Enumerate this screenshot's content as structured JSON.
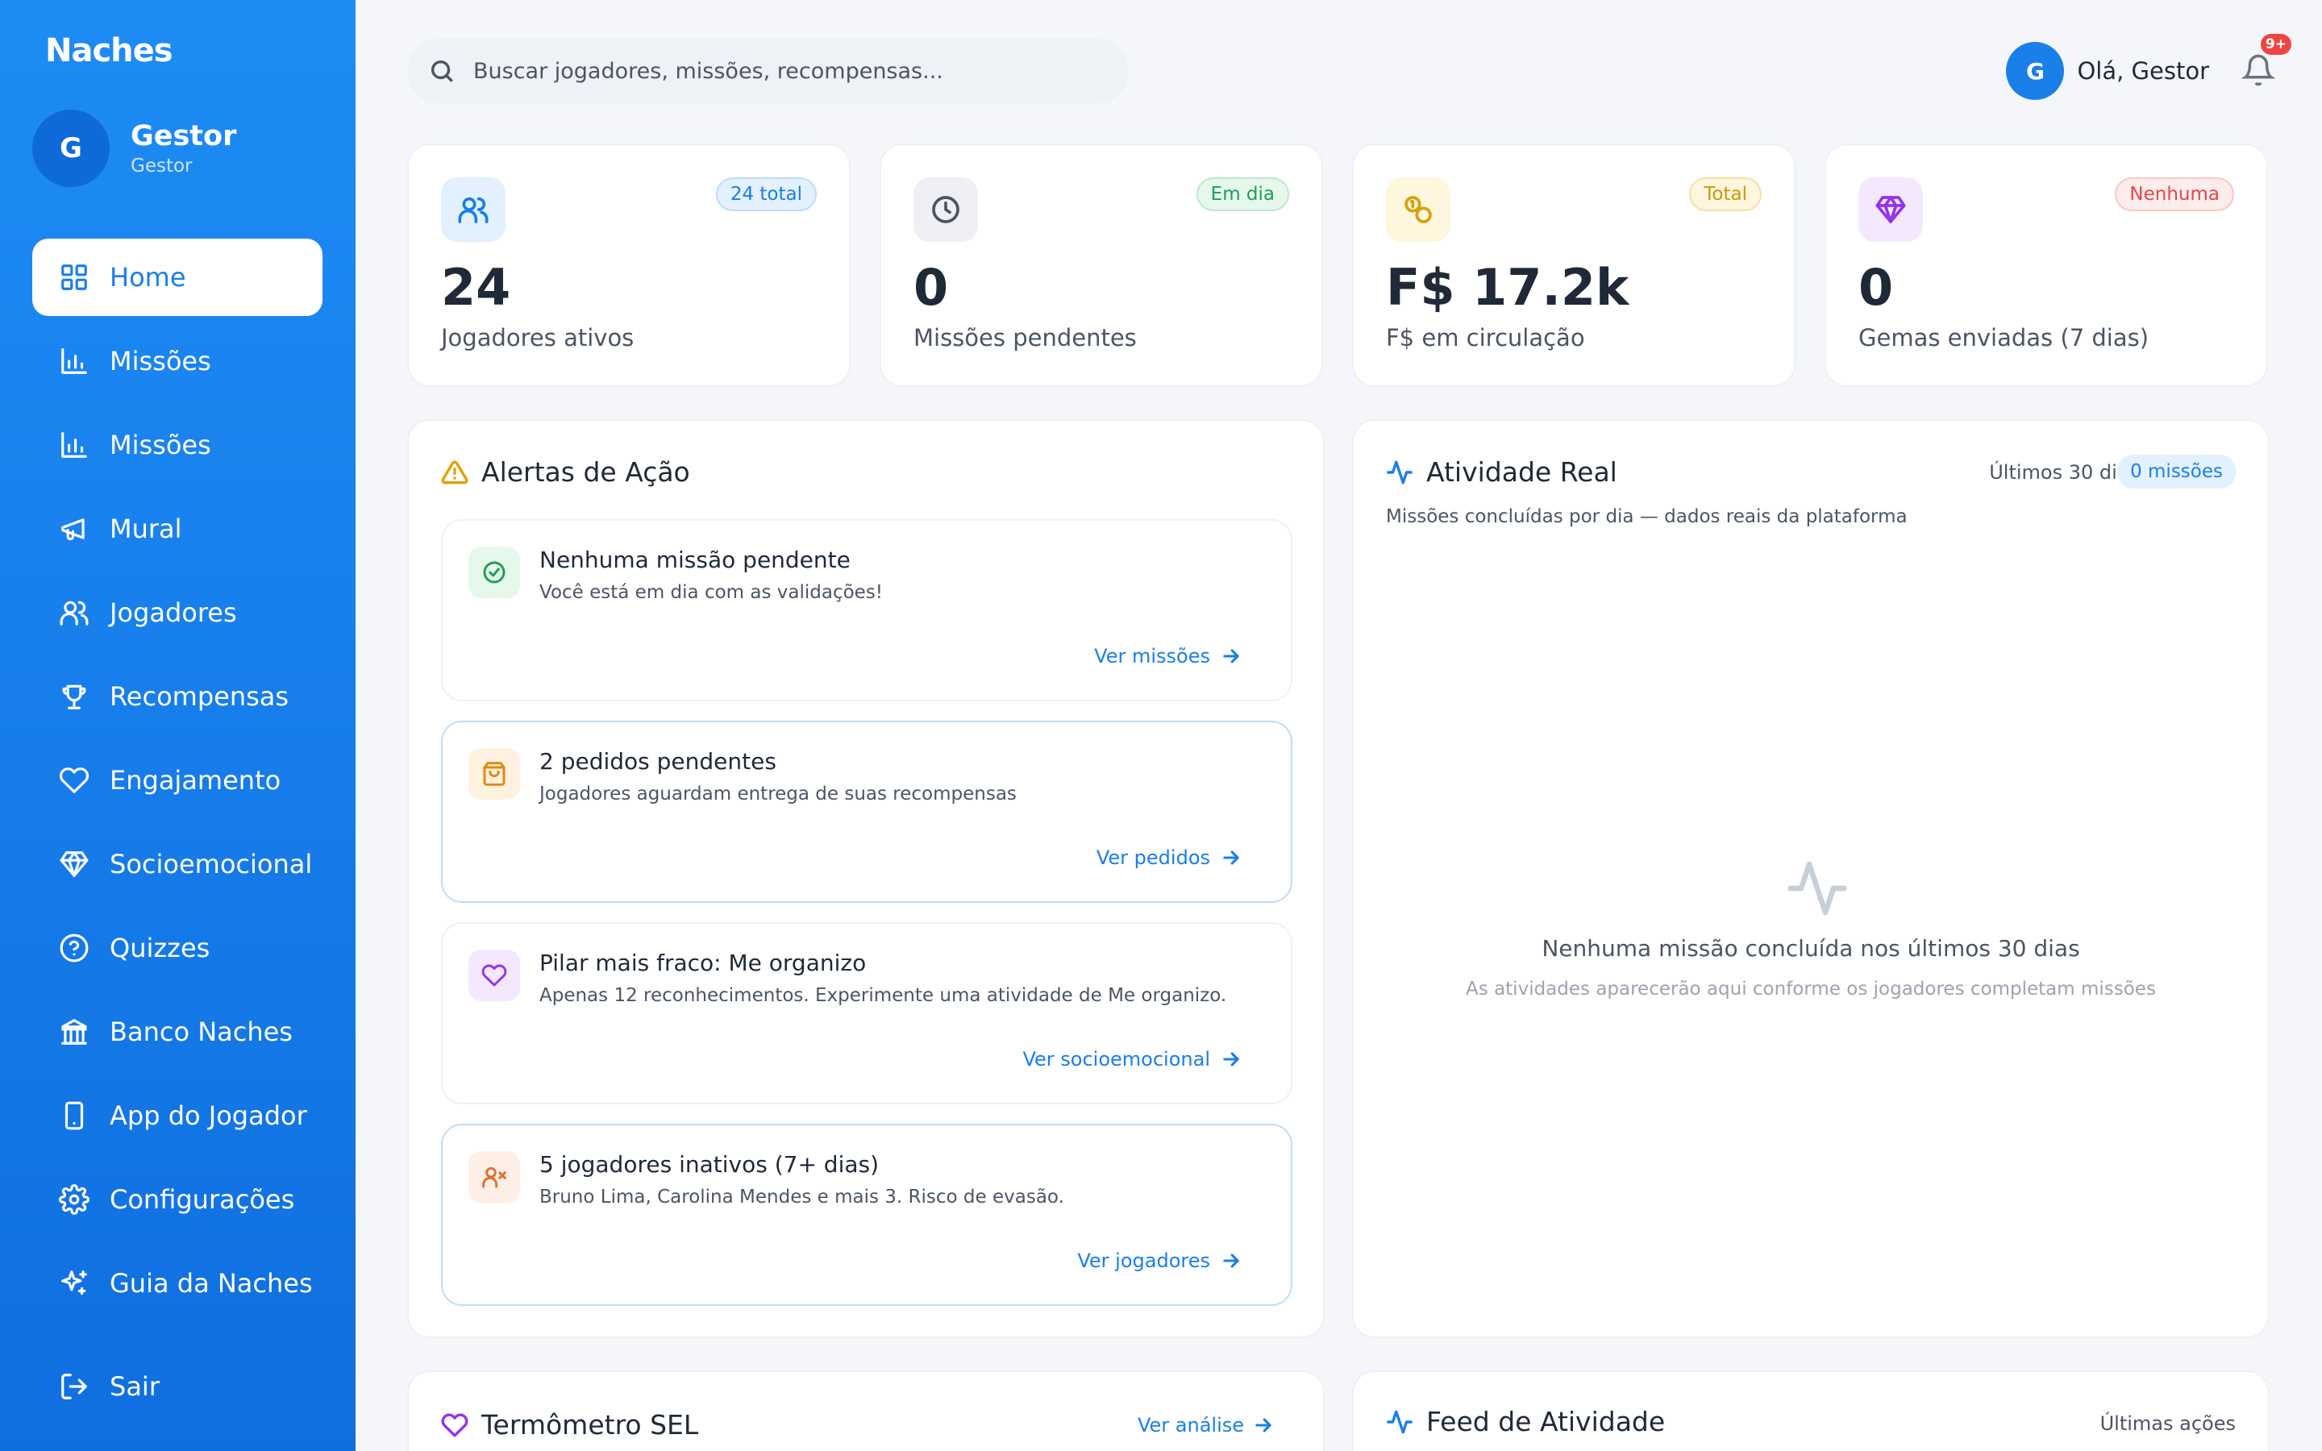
{
  "brand": "Naches",
  "profile": {
    "initial": "G",
    "name": "Gestor",
    "role": "Gestor"
  },
  "nav": [
    {
      "label": "Home",
      "icon": "grid-icon"
    },
    {
      "label": "Missões",
      "icon": "bar-chart-icon"
    },
    {
      "label": "Missões",
      "icon": "bar-chart-icon"
    },
    {
      "label": "Mural",
      "icon": "megaphone-icon"
    },
    {
      "label": "Jogadores",
      "icon": "users-icon"
    },
    {
      "label": "Recompensas",
      "icon": "trophy-icon"
    },
    {
      "label": "Engajamento",
      "icon": "heart-icon"
    },
    {
      "label": "Socioemocional",
      "icon": "gem-icon"
    },
    {
      "label": "Quizzes",
      "icon": "help-circle-icon"
    },
    {
      "label": "Banco Naches",
      "icon": "bank-icon"
    },
    {
      "label": "App do Jogador",
      "icon": "smartphone-icon"
    },
    {
      "label": "Configurações",
      "icon": "settings-icon"
    },
    {
      "label": "Guia da Naches",
      "icon": "sparkles-icon"
    }
  ],
  "logout": "Sair",
  "search": {
    "placeholder": "Buscar jogadores, missões, recompensas..."
  },
  "user": {
    "initial": "G",
    "greeting": "Olá, Gestor",
    "notifications": "9+"
  },
  "stats": [
    {
      "pill": "24 total",
      "value": "24",
      "label": "Jogadores ativos"
    },
    {
      "pill": "Em dia",
      "value": "0",
      "label": "Missões pendentes"
    },
    {
      "pill": "Total",
      "value": "F$ 17.2k",
      "label": "F$ em circulação"
    },
    {
      "pill": "Nenhuma",
      "value": "0",
      "label": "Gemas enviadas (7 dias)"
    }
  ],
  "alerts": {
    "title": "Alertas de Ação",
    "items": [
      {
        "title": "Nenhuma missão pendente",
        "desc": "Você está em dia com as validações!",
        "link": "Ver missões"
      },
      {
        "title": "2 pedidos pendentes",
        "desc": "Jogadores aguardam entrega de suas recompensas",
        "link": "Ver pedidos"
      },
      {
        "title": "Pilar mais fraco: Me organizo",
        "desc": "Apenas 12 reconhecimentos. Experimente uma atividade de Me organizo.",
        "link": "Ver socioemocional"
      },
      {
        "title": "5 jogadores inativos (7+ dias)",
        "desc": "Bruno Lima, Carolina Mendes e mais 3. Risco de evasão.",
        "link": "Ver jogadores"
      }
    ]
  },
  "activity": {
    "title": "Atividade Real",
    "range": "Últimos 30 dias",
    "pill": "0 missões",
    "subtitle": "Missões concluídas por dia — dados reais da plataforma",
    "empty_title": "Nenhuma missão concluída nos últimos 30 dias",
    "empty_desc": "As atividades aparecerão aqui conforme os jogadores completam missões"
  },
  "thermometer": {
    "title": "Termômetro SEL",
    "link": "Ver análise"
  },
  "feed": {
    "title": "Feed de Atividade",
    "range": "Últimas ações"
  },
  "colors": {
    "primary": "#1a7fe8",
    "sidebar": "#1e8cf5"
  }
}
